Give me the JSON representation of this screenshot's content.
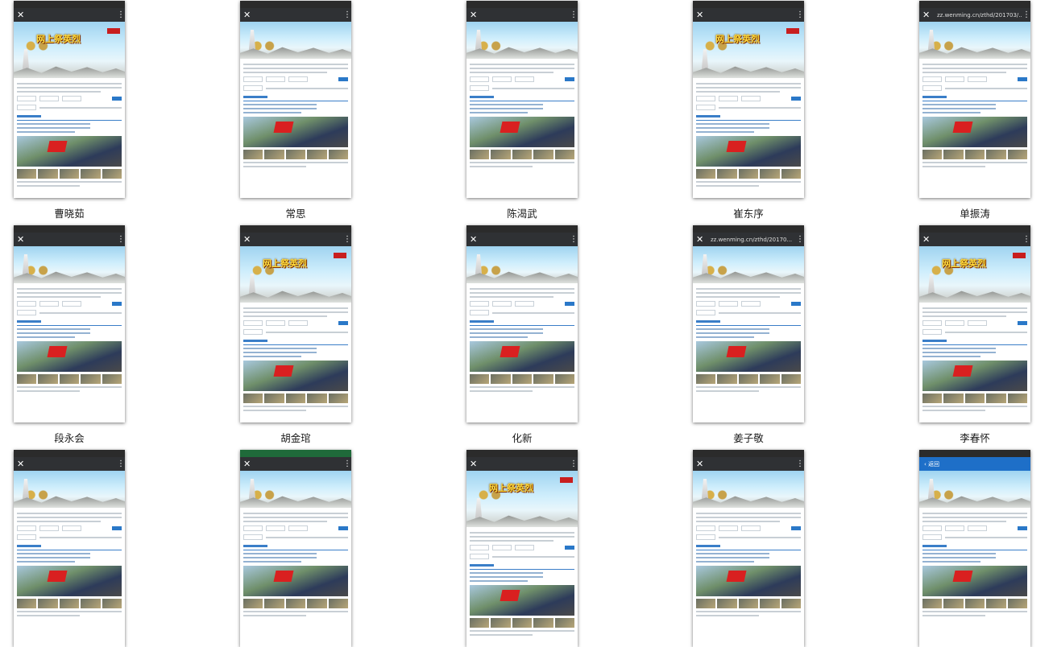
{
  "tiles": [
    {
      "caption": "曹晓茹",
      "variant": "app",
      "status_green": false
    },
    {
      "caption": "常思",
      "variant": "app",
      "status_green": false
    },
    {
      "caption": "陈渴武",
      "variant": "app",
      "status_green": false
    },
    {
      "caption": "崔东序",
      "variant": "app",
      "status_green": false
    },
    {
      "caption": "单振涛",
      "variant": "url",
      "url": "zz.wenming.cn/zthd/201703/...",
      "status_green": false
    },
    {
      "caption": "段永会",
      "variant": "app",
      "status_green": false
    },
    {
      "caption": "胡金琯",
      "variant": "app",
      "status_green": false
    },
    {
      "caption": "化新",
      "variant": "app",
      "status_green": false
    },
    {
      "caption": "姜子敬",
      "variant": "url",
      "url": "zz.wenming.cn/zthd/20170...",
      "status_green": false
    },
    {
      "caption": "李春怀",
      "variant": "app",
      "status_green": false
    },
    {
      "caption": "",
      "variant": "app",
      "status_green": false
    },
    {
      "caption": "",
      "variant": "app",
      "status_green": true
    },
    {
      "caption": "",
      "variant": "app",
      "status_green": false
    },
    {
      "caption": "",
      "variant": "app",
      "status_green": false
    },
    {
      "caption": "",
      "variant": "back",
      "back_label": "返回",
      "status_green": false
    }
  ],
  "banner_text": "网上祭英烈",
  "icons": {
    "close": "close-icon",
    "more": "more-vertical-icon",
    "back": "back-chevron-icon"
  }
}
